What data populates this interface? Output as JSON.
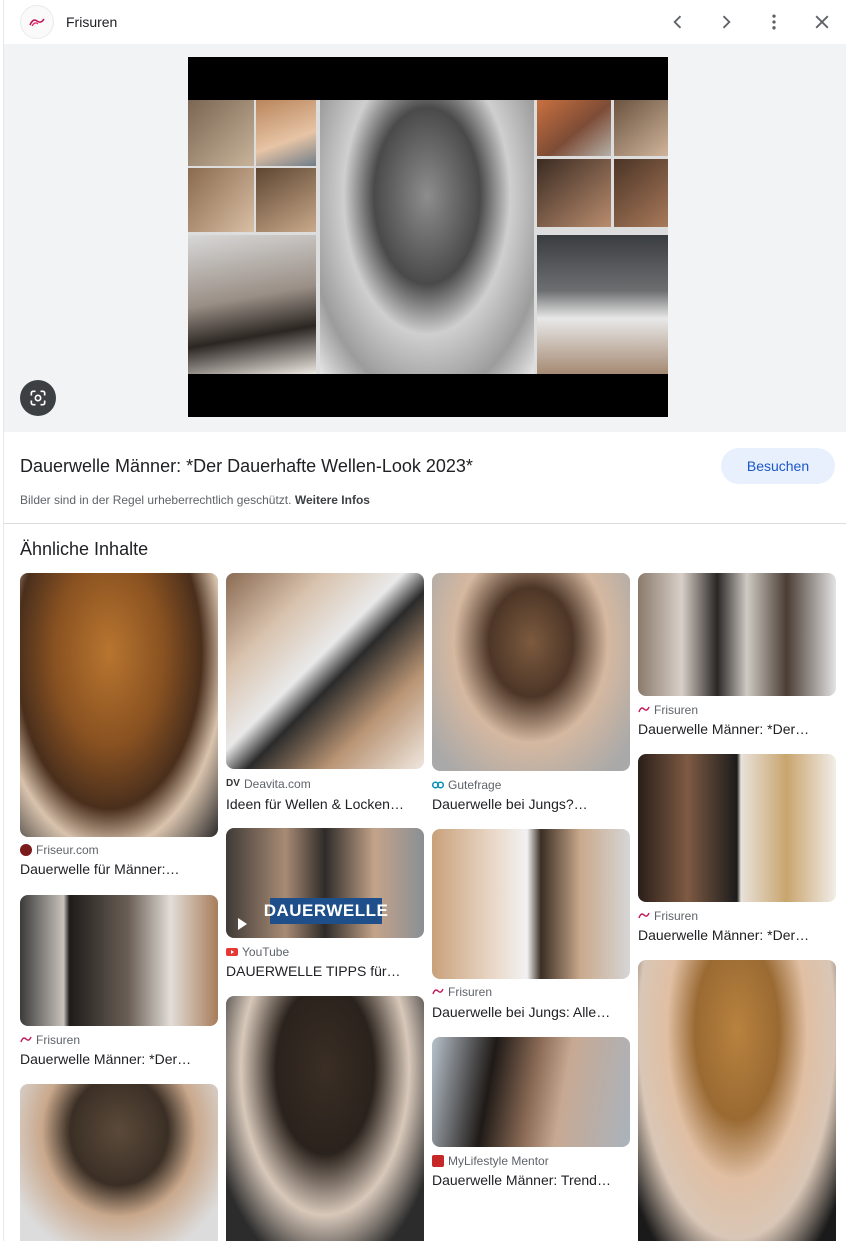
{
  "header": {
    "site_name": "Frisuren",
    "icons": [
      "frisuren-logo-icon",
      "chevron-left-icon",
      "chevron-right-icon",
      "more-vert-icon",
      "close-icon"
    ]
  },
  "preview": {
    "lens_icon": "google-lens-icon"
  },
  "info": {
    "title": "Dauerwelle Männer: *Der Dauerhafte Wellen-Look 2023*",
    "visit_label": "Besuchen",
    "copyright_text": "Bilder sind in der Regel urheberrechtlich geschützt.",
    "more_info_label": "Weitere Infos"
  },
  "similar": {
    "heading": "Ähnliche Inhalte",
    "cards": [
      {
        "source": "Friseur.com",
        "caption": "Dauerwelle für Männer:…"
      },
      {
        "source": "Frisuren",
        "caption": "Dauerwelle Männer: *Der…"
      },
      {
        "source": "Deavita.com",
        "caption": "Ideen für Wellen & Locken…"
      },
      {
        "source": "YouTube",
        "caption": "DAUERWELLE TIPPS für…",
        "overlay": "DAUERWELLE"
      },
      {
        "source": "Gutefrage",
        "caption": "Dauerwelle bei Jungs?…"
      },
      {
        "source": "Frisuren",
        "caption": "Dauerwelle bei Jungs: Alle…"
      },
      {
        "source": "MyLifestyle Mentor",
        "caption": "Dauerwelle Männer: Trend…"
      },
      {
        "source": "Frisuren",
        "caption": "Dauerwelle Männer: *Der…"
      },
      {
        "source": "Frisuren",
        "caption": "Dauerwelle Männer: *Der…"
      }
    ]
  }
}
